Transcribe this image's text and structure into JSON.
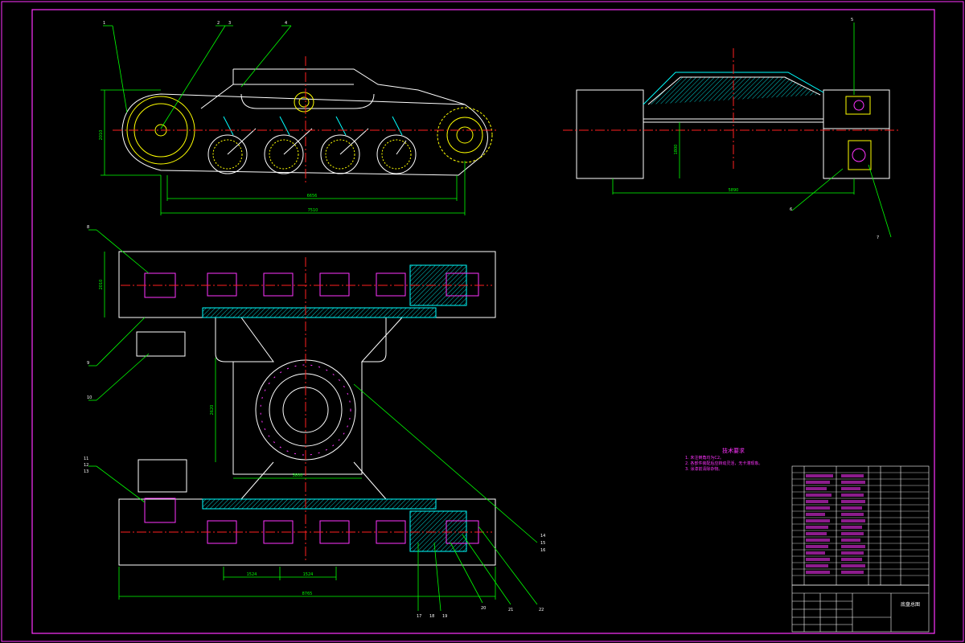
{
  "drawing": {
    "colors": {
      "background": "#000000",
      "frame": "#ff33ff",
      "outline": "#ffffff",
      "dimension": "#00ff00",
      "centerline": "#ff2020",
      "detail": "#ffff00",
      "hatch": "#00ffff",
      "notes": "#ff33ff"
    },
    "dimensions": {
      "side_height": "2010",
      "side_inner_length": "6656",
      "side_overall_length": "7510",
      "right_height": "1800",
      "right_length": "5890",
      "plan_width": "2010",
      "center_height": "2620",
      "center_width": "3800",
      "bay_left": "1524",
      "bay_right": "1524",
      "plan_overall_length": "8765"
    },
    "balloons": {
      "side": [
        "1",
        "2",
        "3",
        "4"
      ],
      "right": [
        "5",
        "6",
        "7"
      ],
      "plan_left": [
        "8",
        "9",
        "10",
        "11",
        "12",
        "13"
      ],
      "plan_right": [
        "14",
        "15",
        "16",
        "17",
        "18",
        "19",
        "20",
        "21",
        "22"
      ]
    },
    "technical_notes": {
      "title": "技术要求",
      "lines": [
        "1. 未注倒角均为C2。",
        "2. 各部件装配后应转动灵活，无卡滞现象。",
        "3. 涂漆前清除杂物。"
      ]
    },
    "title_block": {
      "name": "底盘总图"
    }
  }
}
